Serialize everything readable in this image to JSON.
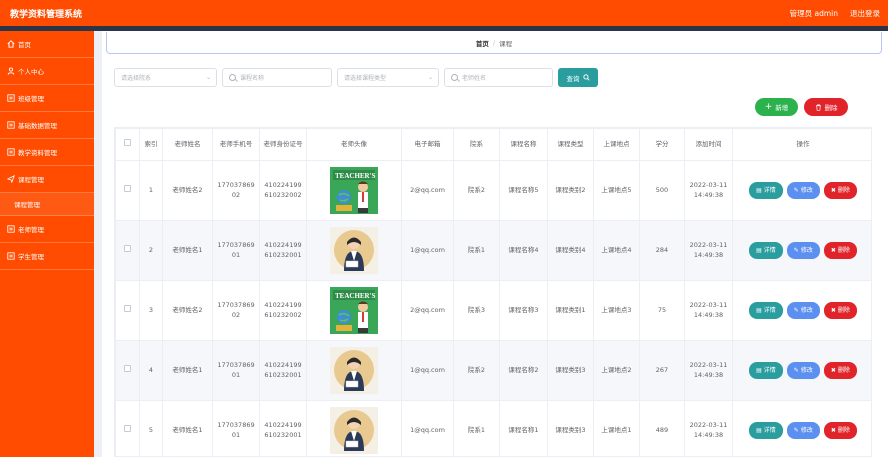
{
  "header": {
    "app_title": "教学资料管理系统",
    "admin_text": "管理员 admin",
    "logout_label": "退出登录"
  },
  "sidebar": {
    "items": [
      {
        "label": "首页",
        "icon": "home-icon"
      },
      {
        "label": "个人中心",
        "icon": "user-icon"
      },
      {
        "label": "班级管理",
        "icon": "menu-icon"
      },
      {
        "label": "基础数据管理",
        "icon": "menu-icon"
      },
      {
        "label": "教学资料管理",
        "icon": "menu-icon"
      },
      {
        "label": "课程管理",
        "icon": "send-icon",
        "sub": "课程管理"
      },
      {
        "label": "老师管理",
        "icon": "menu-icon"
      },
      {
        "label": "学生管理",
        "icon": "menu-icon"
      }
    ]
  },
  "breadcrumb": {
    "home": "首页",
    "separator": "/",
    "current": "课程"
  },
  "filters": {
    "department_placeholder": "请选择院系",
    "course_name_placeholder": "课程名称",
    "course_type_placeholder": "请选择课程类型",
    "teacher_name_placeholder": "老师姓名",
    "query_label": "查询"
  },
  "actions": {
    "add_label": "新增",
    "delete_label": "删除"
  },
  "table": {
    "headers": [
      "索引",
      "老师姓名",
      "老师手机号",
      "老师身份证号",
      "老师头像",
      "电子邮箱",
      "院系",
      "课程名称",
      "课程类型",
      "上课地点",
      "学分",
      "添加时间",
      "操作"
    ],
    "row_buttons": {
      "detail": "详情",
      "edit": "修改",
      "delete": "删除"
    },
    "rows": [
      {
        "index": "1",
        "teacher": "老师姓名2",
        "phone": "17703786902",
        "idcard": "410224199610232002",
        "avatar": "teacher-day-poster",
        "email": "2@qq.com",
        "dept": "院系2",
        "course": "课程名称5",
        "type": "课程类别2",
        "location": "上课地点5",
        "credit": "500",
        "date": "2022-03-11",
        "time": "14:49:38"
      },
      {
        "index": "2",
        "teacher": "老师姓名1",
        "phone": "17703786901",
        "idcard": "410224199610232001",
        "avatar": "teacher-portrait",
        "email": "1@qq.com",
        "dept": "院系1",
        "course": "课程名称4",
        "type": "课程类别4",
        "location": "上课地点4",
        "credit": "284",
        "date": "2022-03-11",
        "time": "14:49:38"
      },
      {
        "index": "3",
        "teacher": "老师姓名2",
        "phone": "17703786902",
        "idcard": "410224199610232002",
        "avatar": "teacher-day-poster",
        "email": "2@qq.com",
        "dept": "院系3",
        "course": "课程名称3",
        "type": "课程类别1",
        "location": "上课地点3",
        "credit": "75",
        "date": "2022-03-11",
        "time": "14:49:38"
      },
      {
        "index": "4",
        "teacher": "老师姓名1",
        "phone": "17703786901",
        "idcard": "410224199610232001",
        "avatar": "teacher-portrait",
        "email": "1@qq.com",
        "dept": "院系2",
        "course": "课程名称2",
        "type": "课程类别3",
        "location": "上课地点2",
        "credit": "267",
        "date": "2022-03-11",
        "time": "14:49:38"
      },
      {
        "index": "5",
        "teacher": "老师姓名1",
        "phone": "17703786901",
        "idcard": "410224199610232001",
        "avatar": "teacher-portrait",
        "email": "1@qq.com",
        "dept": "院系1",
        "course": "课程名称1",
        "type": "课程类别3",
        "location": "上课地点1",
        "credit": "489",
        "date": "2022-03-11",
        "time": "14:49:38"
      }
    ]
  },
  "colors": {
    "brand": "#ff4c00",
    "teal": "#2a9d9f",
    "blue": "#5b8ff0",
    "red": "#e0242a",
    "green": "#2bb24c"
  }
}
